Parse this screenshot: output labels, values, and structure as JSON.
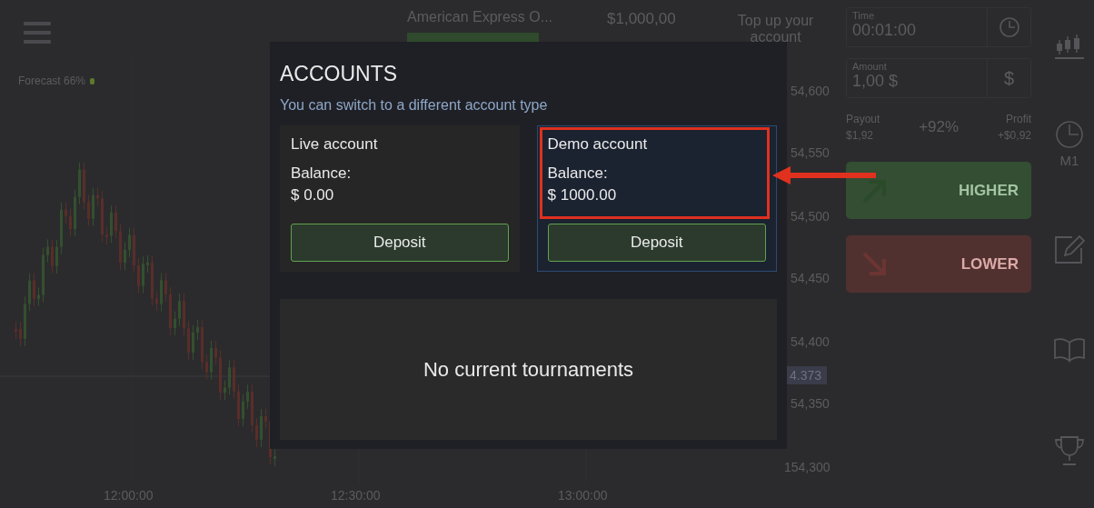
{
  "top_bar": {
    "asset_name": "American Express O...",
    "balance": "$1,000,00",
    "top_up": "Top up your account"
  },
  "chart": {
    "forecast": "Forecast 66%",
    "price_labels": [
      "54,600",
      "54,550",
      "54,500",
      "54,450",
      "54,400",
      "54,350",
      "154,300"
    ],
    "current_price": "4.373",
    "time_labels": [
      "12:00:00",
      "12:30:00",
      "13:00:00"
    ]
  },
  "trade_panel": {
    "time": {
      "label": "Time",
      "value": "00:01:00"
    },
    "amount": {
      "label": "Amount",
      "value": "1,00 $",
      "currency": "$"
    },
    "payout": {
      "label": "Payout",
      "value": "$1,92"
    },
    "percent": "+92%",
    "profit": {
      "label": "Profit",
      "value": "+$0,92"
    },
    "buttons": [
      {
        "kind": "higher",
        "label": "HIGHER"
      },
      {
        "kind": "lower",
        "label": "LOWER"
      }
    ]
  },
  "tools": {
    "timeframe": "M1"
  },
  "modal": {
    "title": "ACCOUNTS",
    "subtitle": "You can switch to a different account type",
    "accounts": [
      {
        "name": "Live account",
        "balance_label": "Balance:",
        "balance": "$ 0.00",
        "button": "Deposit",
        "selected": false
      },
      {
        "name": "Demo account",
        "balance_label": "Balance:",
        "balance": "$ 1000.00",
        "button": "Deposit",
        "selected": true
      }
    ],
    "tournaments": "No current tournaments"
  }
}
